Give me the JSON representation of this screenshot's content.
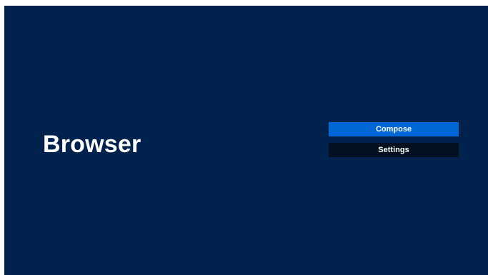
{
  "app": {
    "title": "Browser"
  },
  "menu": {
    "items": [
      {
        "label": "Compose",
        "state": "focused"
      },
      {
        "label": "Settings",
        "state": "normal"
      }
    ]
  },
  "colors": {
    "background": "#00224d",
    "focused_item": "#0068d6",
    "normal_item": "#02101f",
    "text": "#ffffff"
  }
}
